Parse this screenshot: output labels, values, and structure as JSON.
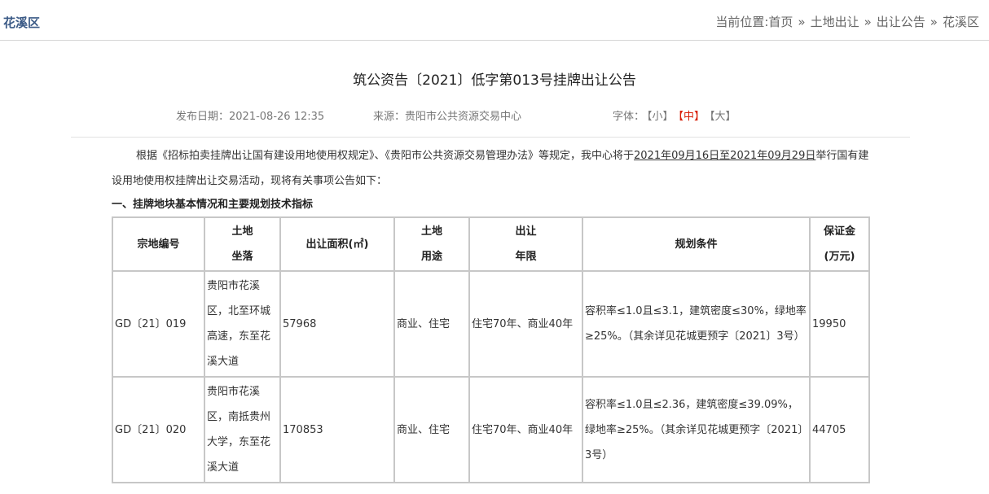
{
  "header": {
    "district": "花溪区",
    "breadcrumb_prefix": "当前位置:",
    "breadcrumb": [
      "首页",
      "土地出让",
      "出让公告",
      "花溪区"
    ],
    "separator": "»"
  },
  "article": {
    "title": "筑公资告〔2021〕低字第013号挂牌出让公告",
    "publish_label": "发布日期：",
    "publish_date": "2021-08-26 12:35",
    "source_label": "来源：",
    "source": "贵阳市公共资源交易中心",
    "font_label": "字体：",
    "font_small": "【小】",
    "font_medium": "【中】",
    "font_large": "【大】",
    "intro_before": "根据《招标拍卖挂牌出让国有建设用地使用权规定》、《贵阳市公共资源交易管理办法》等规定，我中心将于",
    "intro_date_range": "2021年09月16日至2021年09月29日",
    "intro_after": "举行国有建设用地使用权挂牌出让交易活动，现将有关事项公告如下：",
    "section1_title": "一、挂牌地块基本情况和主要规划技术指标"
  },
  "table": {
    "headers": {
      "id": "宗地编号",
      "loc_l1": "土地",
      "loc_l2": "坐落",
      "area": "出让面积(㎡)",
      "use_l1": "土地",
      "use_l2": "用途",
      "term_l1": "出让",
      "term_l2": "年限",
      "plan": "规划条件",
      "dep_l1": "保证金",
      "dep_l2": "(万元)"
    },
    "rows": [
      {
        "id": "GD〔21〕019",
        "location": "贵阳市花溪区，北至环城高速，东至花溪大道",
        "area": "57968",
        "use": "商业、住宅",
        "term": "住宅70年、商业40年",
        "plan": "容积率≤1.0且≤3.1，建筑密度≤30%，绿地率≥25%。（其余详见花城更预字〔2021〕3号）",
        "deposit": "19950"
      },
      {
        "id": "GD〔21〕020",
        "location": "贵阳市花溪区，南抵贵州大学，东至花溪大道",
        "area": "170853",
        "use": "商业、住宅",
        "term": "住宅70年、商业40年",
        "plan": "容积率≤1.0且≤2.36，建筑密度≤39.09%，绿地率≥25%。（其余详见花城更预字〔2021〕3号）",
        "deposit": "44705"
      }
    ]
  },
  "colors": {
    "accent": "#3b5a86",
    "active_font": "#d81e06",
    "border": "#c7c7c7"
  }
}
